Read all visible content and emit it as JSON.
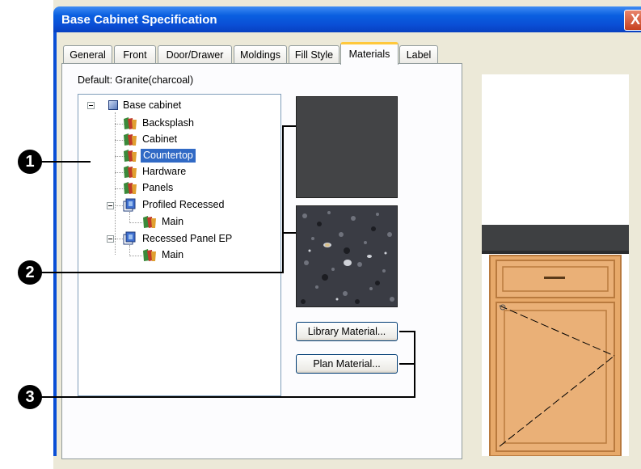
{
  "window": {
    "title": "Base Cabinet Specification",
    "close_glyph": "X"
  },
  "tabs": [
    {
      "label": "General"
    },
    {
      "label": "Front"
    },
    {
      "label": "Door/Drawer"
    },
    {
      "label": "Moldings"
    },
    {
      "label": "Fill Style"
    },
    {
      "label": "Materials",
      "active": true
    },
    {
      "label": "Label"
    }
  ],
  "materials": {
    "default_label": "Default: Granite(charcoal)",
    "tree": [
      {
        "label": "Base cabinet",
        "icon": "cabinet-cube-icon",
        "level": 0,
        "expander": "minus"
      },
      {
        "label": "Backsplash",
        "icon": "material-swatch-icon",
        "level": 1
      },
      {
        "label": "Cabinet",
        "icon": "material-swatch-icon",
        "level": 1
      },
      {
        "label": "Countertop",
        "icon": "material-swatch-icon",
        "level": 1,
        "selected": true
      },
      {
        "label": "Hardware",
        "icon": "material-swatch-icon",
        "level": 1
      },
      {
        "label": "Panels",
        "icon": "material-swatch-icon",
        "level": 1
      },
      {
        "label": "Profiled Recessed",
        "icon": "panel-door-icon",
        "level": 1,
        "expander": "minus"
      },
      {
        "label": "Main",
        "icon": "material-swatch-icon",
        "level": 2
      },
      {
        "label": "Recessed Panel EP",
        "icon": "panel-door-icon",
        "level": 1,
        "expander": "minus"
      },
      {
        "label": "Main",
        "icon": "material-swatch-icon",
        "level": 2
      }
    ],
    "buttons": {
      "library": "Library Material...",
      "plan": "Plan Material..."
    },
    "swatch_colors": {
      "flat": "#434446",
      "granite_base": "#3a3c44"
    }
  },
  "callouts": [
    "1",
    "2",
    "3"
  ],
  "preview": {
    "countertop_color": "#3e4042",
    "cabinet_color": "#e7a96a",
    "trim_color": "#b97a3e"
  }
}
